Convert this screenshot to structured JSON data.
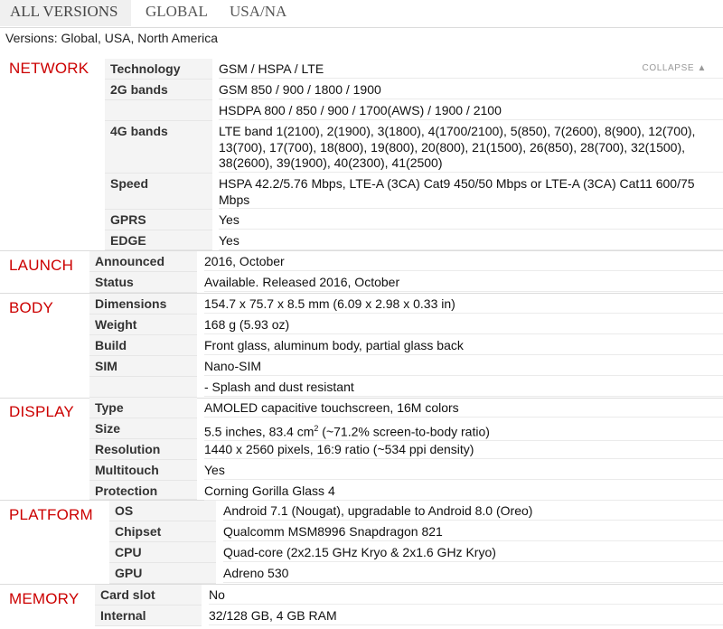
{
  "tabs": [
    "ALL VERSIONS",
    "GLOBAL",
    "USA/NA"
  ],
  "versions_line": "Versions: Global, USA, North America",
  "collapse_label": "COLLAPSE ▲",
  "network": {
    "title": "NETWORK",
    "rows": [
      {
        "k": "Technology",
        "v": "GSM / HSPA / LTE"
      },
      {
        "k": "2G bands",
        "v": "GSM 850 / 900 / 1800 / 1900"
      },
      {
        "k": "",
        "v": "HSDPA 800 / 850 / 900 / 1700(AWS) / 1900 / 2100"
      },
      {
        "k": "4G bands",
        "v": "LTE band 1(2100), 2(1900), 3(1800), 4(1700/2100), 5(850), 7(2600), 8(900), 12(700), 13(700), 17(700), 18(800), 19(800), 20(800), 21(1500), 26(850), 28(700), 32(1500), 38(2600), 39(1900), 40(2300), 41(2500)"
      },
      {
        "k": "Speed",
        "v": "HSPA 42.2/5.76 Mbps, LTE-A (3CA) Cat9 450/50 Mbps or LTE-A (3CA) Cat11 600/75 Mbps"
      },
      {
        "k": "GPRS",
        "v": "Yes"
      },
      {
        "k": "EDGE",
        "v": "Yes"
      }
    ]
  },
  "launch": {
    "title": "LAUNCH",
    "rows": [
      {
        "k": "Announced",
        "v": "2016, October"
      },
      {
        "k": "Status",
        "v": "Available. Released 2016, October"
      }
    ]
  },
  "body_sec": {
    "title": "BODY",
    "rows": [
      {
        "k": "Dimensions",
        "v": "154.7 x 75.7 x 8.5 mm (6.09 x 2.98 x 0.33 in)"
      },
      {
        "k": "Weight",
        "v": "168 g (5.93 oz)"
      },
      {
        "k": "Build",
        "v": "Front glass, aluminum body, partial glass back"
      },
      {
        "k": "SIM",
        "v": "Nano-SIM"
      },
      {
        "k": "",
        "v": "- Splash and dust resistant"
      }
    ]
  },
  "display": {
    "title": "DISPLAY",
    "rows": [
      {
        "k": "Type",
        "v": "AMOLED capacitive touchscreen, 16M colors"
      },
      {
        "k": "Size",
        "v_pre": "5.5 inches, 83.4 cm",
        "v_sup": "2",
        "v_post": " (~71.2% screen-to-body ratio)"
      },
      {
        "k": "Resolution",
        "v": "1440 x 2560 pixels, 16:9 ratio (~534 ppi density)"
      },
      {
        "k": "Multitouch",
        "v": "Yes"
      },
      {
        "k": "Protection",
        "v": "Corning Gorilla Glass 4"
      }
    ]
  },
  "platform": {
    "title": "PLATFORM",
    "rows": [
      {
        "k": "OS",
        "v": "Android 7.1 (Nougat), upgradable to Android 8.0 (Oreo)"
      },
      {
        "k": "Chipset",
        "v": "Qualcomm MSM8996 Snapdragon 821"
      },
      {
        "k": "CPU",
        "v": "Quad-core (2x2.15 GHz Kryo & 2x1.6 GHz Kryo)"
      },
      {
        "k": "GPU",
        "v": "Adreno 530"
      }
    ]
  },
  "memory": {
    "title": "MEMORY",
    "rows": [
      {
        "k": "Card slot",
        "v": "No"
      },
      {
        "k": "Internal",
        "v": "32/128 GB, 4 GB RAM"
      }
    ]
  }
}
